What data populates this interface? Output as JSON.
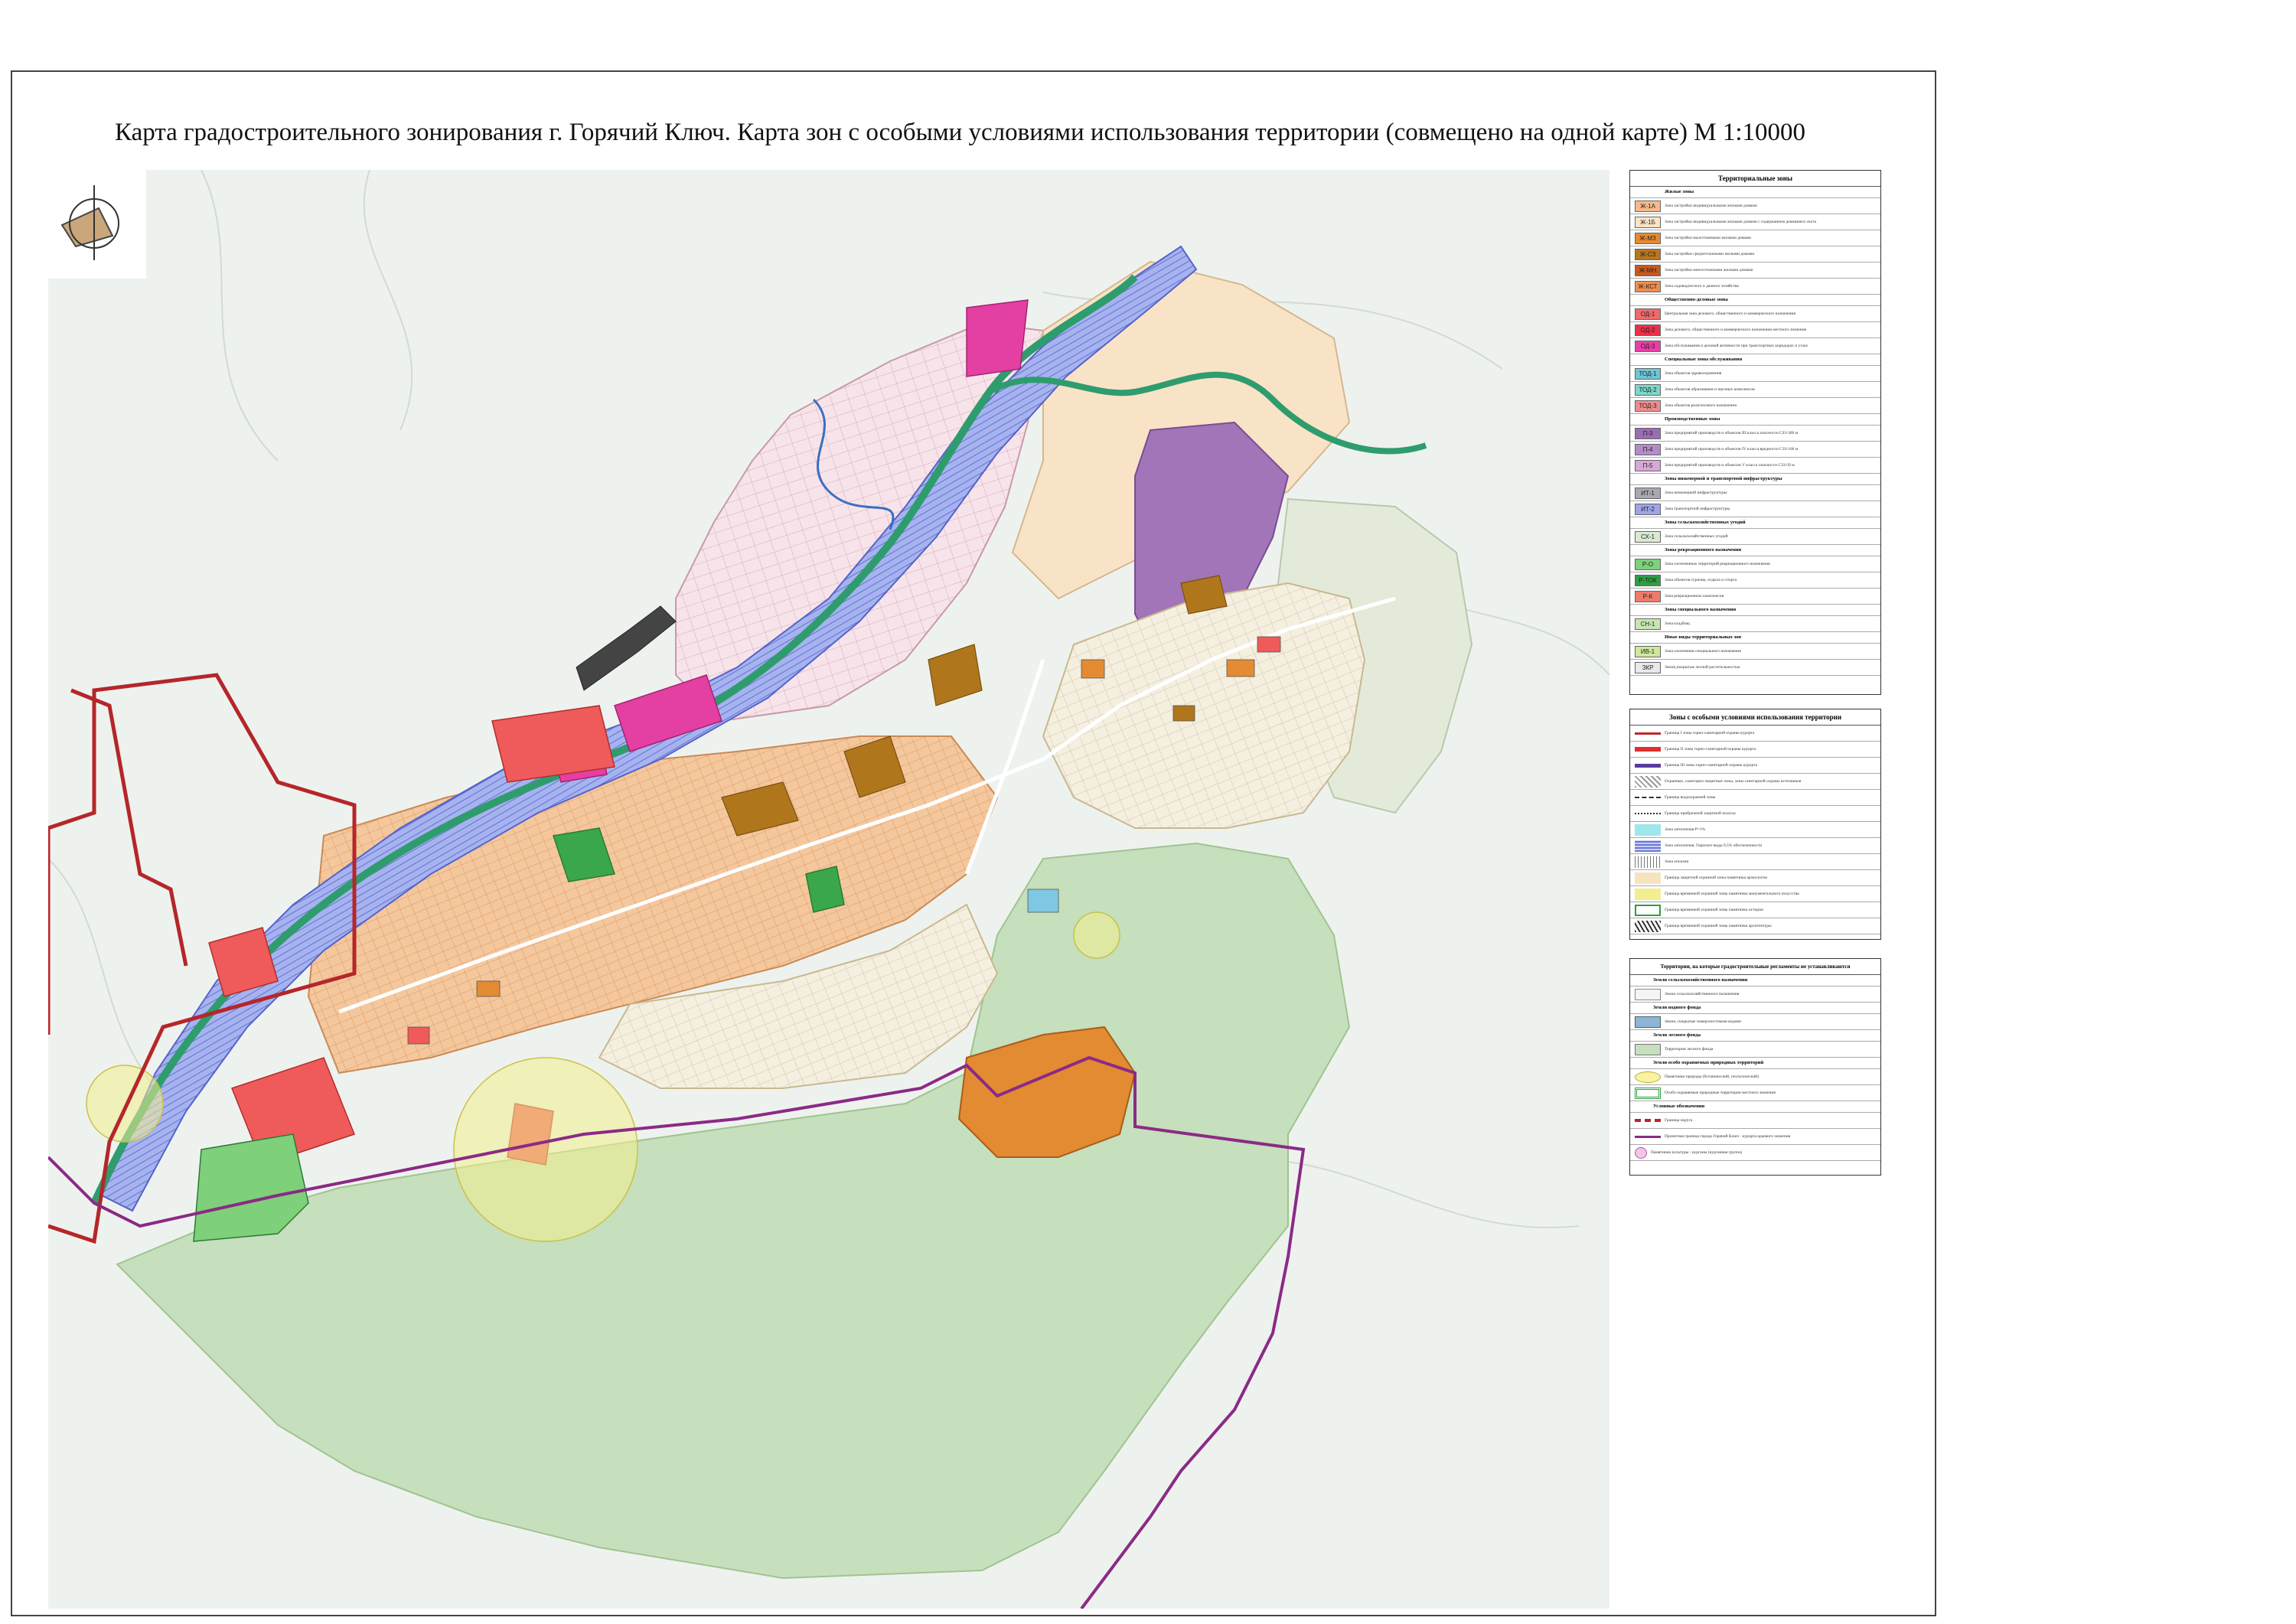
{
  "title": "Карта градостроительного зонирования г. Горячий Ключ. Карта зон с особыми условиями использования территории (совмещено на одной карте) М 1:10000",
  "legend_zones": {
    "header": "Территориальные зоны",
    "sections": [
      {
        "title": "Жилые зоны",
        "items": [
          {
            "code": "Ж-1А",
            "color": "#f6b98d",
            "text": "Зона застройки индивидуальными жилыми домами"
          },
          {
            "code": "Ж-1Б",
            "color": "#fbe3c6",
            "text": "Зона застройки индивидуальными жилыми домами с содержанием домашнего скота"
          },
          {
            "code": "Ж-МЗ",
            "color": "#e8892f",
            "text": "Зона застройки малоэтажными жилыми домами"
          },
          {
            "code": "Ж-СЗ",
            "color": "#b8761d",
            "text": "Зона застройки среднеэтажными жилыми домами"
          },
          {
            "code": "Ж-МН",
            "color": "#c85a1c",
            "text": "Зона застройки многоэтажными жилыми домами"
          },
          {
            "code": "Ж-КСТ",
            "color": "#ef8d4e",
            "text": "Зона садоводческого и дачного хозяйства"
          }
        ]
      },
      {
        "title": "Общественно-деловые зоны",
        "items": [
          {
            "code": "ОД-1",
            "color": "#f06a6a",
            "text": "Центральная зона делового, общественного и коммерческого назначения"
          },
          {
            "code": "ОД-2",
            "color": "#ee2f49",
            "text": "Зона делового, общественного и коммерческого назначения местного значения"
          },
          {
            "code": "ОД-3",
            "color": "#e83fa8",
            "text": "Зона обслуживания и деловой активности при транспортных коридорах и узлах"
          }
        ]
      },
      {
        "title": "Специальные зоны обслуживания",
        "items": [
          {
            "code": "ТОД-1",
            "color": "#6dc6d7",
            "text": "Зона объектов здравоохранения"
          },
          {
            "code": "ТОД-2",
            "color": "#7bd8c8",
            "text": "Зона объектов образования и научных комплексов"
          },
          {
            "code": "ТОД-3",
            "color": "#f08c8c",
            "text": "Зона объектов религиозного назначения"
          }
        ]
      },
      {
        "title": "Производственные зоны",
        "items": [
          {
            "code": "П-3",
            "color": "#9a6db3",
            "text": "Зона предприятий производств и объектов III класса опасности СЗЗ-300 м"
          },
          {
            "code": "П-4",
            "color": "#b48bc7",
            "text": "Зона предприятий производств и объектов IV класса вредности СЗЗ-100 м"
          },
          {
            "code": "П-5",
            "color": "#d6a8d6",
            "text": "Зона предприятий производств и объектов V класса опасности СЗЗ-50 м"
          }
        ]
      },
      {
        "title": "Зоны инженерной и транспортной инфраструктуры",
        "items": [
          {
            "code": "ИТ-1",
            "color": "#a8a8b0",
            "text": "Зона инженерной инфраструктуры"
          },
          {
            "code": "ИТ-2",
            "color": "#9fa3e8",
            "text": "Зона транспортной инфраструктуры"
          }
        ]
      },
      {
        "title": "Зоны сельскохозяйственных угодий",
        "items": [
          {
            "code": "СХ-1",
            "color": "#d9ead0",
            "text": "Зона сельскохозяйственных угодий"
          }
        ]
      },
      {
        "title": "Зоны рекреационного назначения",
        "items": [
          {
            "code": "Р-О",
            "color": "#7ed07a",
            "text": "Зона озелененных территорий рекреационного назначения"
          },
          {
            "code": "Р-ТОК",
            "color": "#2f9e43",
            "text": "Зона объектов туризма, отдыха и спорта"
          },
          {
            "code": "Р-К",
            "color": "#f07a6a",
            "text": "Зона рекреационных комплексов"
          }
        ]
      },
      {
        "title": "Зоны специального назначения",
        "items": [
          {
            "code": "СН-1",
            "color": "#c8e6b0",
            "text": "Зона кладбищ"
          }
        ]
      },
      {
        "title": "Иные виды территориальных зон",
        "items": [
          {
            "code": "ИВ-1",
            "color": "#cfe89e",
            "text": "Зона озеленения специального назначения"
          },
          {
            "code": "ЗКР",
            "color": "#e9e9e9",
            "text": "Земли,покрытые лесной растительностью"
          }
        ]
      }
    ]
  },
  "legend_special": {
    "header": "Зоны с особыми условиями использования территории",
    "items": [
      {
        "sym": "line-red",
        "text": "Граница I зоны горно-санитарной охраны курорта"
      },
      {
        "sym": "line-redthick",
        "text": "Граница II зоны горно-санитарной охраны курорта"
      },
      {
        "sym": "line-purple",
        "text": "Граница III зоны горно-санитарной охраны курорта"
      },
      {
        "sym": "hatch-gray",
        "text": "Охранные, санитарно-защитные зоны, зоны санитарной охраны источников"
      },
      {
        "sym": "dash",
        "text": "Граница водоохранной зоны"
      },
      {
        "sym": "dash2",
        "text": "Граница прибрежной защитной полосы"
      },
      {
        "sym": "cyan",
        "text": "Зона затопления Р=1%"
      },
      {
        "sym": "stripe-blue",
        "text": "Зона затопления. Горизонт воды 0,5% обеспеченности"
      },
      {
        "sym": "hatch-arc",
        "text": "Зона оползня"
      },
      {
        "sym": "beige",
        "text": "Граница защитной охранной зоны памятника археологии"
      },
      {
        "sym": "yellow",
        "text": "Граница временной охранной зоны памятника монументального искусства"
      },
      {
        "sym": "green-line",
        "text": "Граница временной охранной зоны памятника истории"
      },
      {
        "sym": "hatch-dark",
        "text": "Граница временной охранной зоны памятника архитектуры"
      }
    ]
  },
  "legend_other": {
    "header": "Территории, на которые градостроительные регламенты не устанавливаются",
    "items": [
      {
        "kind": "sec",
        "text": "Земли сельскохозяйственного назначения"
      },
      {
        "kind": "row",
        "sym": "plain",
        "text": "Земли сельскохозяйственного назначения"
      },
      {
        "kind": "sec",
        "text": "Земли водного фонда"
      },
      {
        "kind": "row",
        "sym": "blue",
        "text": "Земли, покрытые поверхностными водами"
      },
      {
        "kind": "sec",
        "text": "Земли лесного фонда"
      },
      {
        "kind": "row",
        "sym": "forest",
        "text": "Территории лесного фонда"
      },
      {
        "kind": "sec",
        "text": "Земли особо охраняемых природных территорий"
      },
      {
        "kind": "row",
        "sym": "yellow-oval",
        "text": "Памятники природы (ботанический, геологический)"
      },
      {
        "kind": "row",
        "sym": "green-frame",
        "text": "Особо охраняемые природные территории местного значения"
      },
      {
        "kind": "sec",
        "text": "Условные обозначения"
      },
      {
        "kind": "row",
        "sym": "boundary",
        "text": "Граница округа"
      },
      {
        "kind": "row",
        "sym": "boundary-purple",
        "text": "Проектная граница города Горячий Ключ - курорта краевого значения"
      },
      {
        "kind": "row",
        "sym": "pink-circle",
        "text": "Памятники культуры - курганы (курганная группа)"
      }
    ]
  },
  "colors": {
    "background_map": "#eef2ee",
    "forest": "#c6dfbc",
    "river": "#3d9b78",
    "boundary": "#b5262a",
    "boundary_purple": "#8b2a86"
  }
}
